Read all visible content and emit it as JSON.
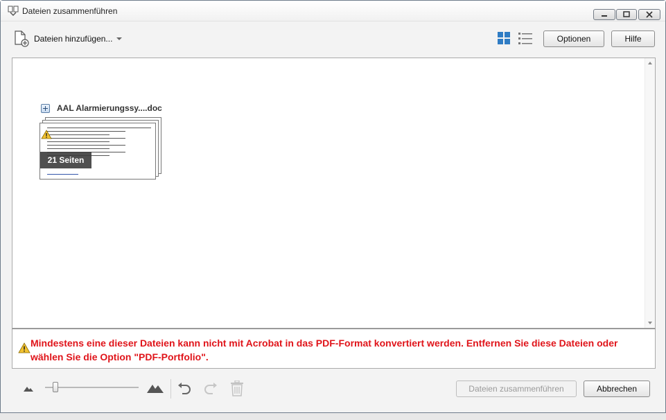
{
  "window": {
    "title": "Dateien zusammenführen"
  },
  "toolbar": {
    "add_files_label": "Dateien hinzufügen...",
    "options_label": "Optionen",
    "help_label": "Hilfe"
  },
  "file": {
    "name": "AAL Alarmierungssy....doc",
    "pages_badge": "21 Seiten"
  },
  "error": {
    "message": "Mindestens eine dieser Dateien kann nicht mit Acrobat in das PDF-Format konvertiert werden. Entfernen Sie diese Dateien oder wählen Sie die Option \"PDF-Portfolio\"."
  },
  "footer": {
    "merge_label": "Dateien zusammenführen",
    "cancel_label": "Abbrechen"
  },
  "colors": {
    "accent_blue": "#2f7cc4",
    "error_red": "#e0141a"
  }
}
